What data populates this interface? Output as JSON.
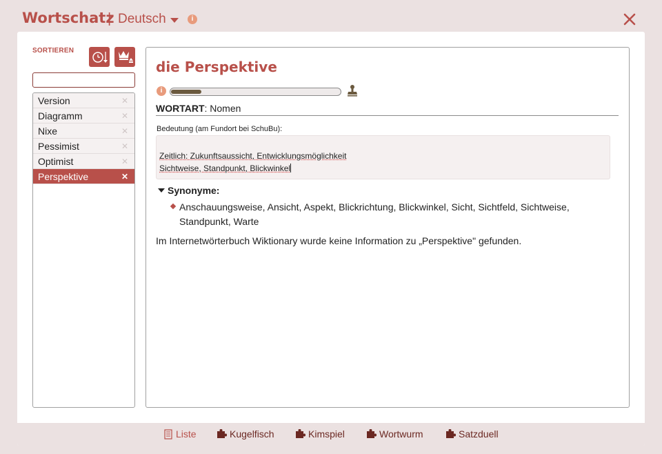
{
  "header": {
    "app_title": "Wortschatz",
    "separator": "|",
    "language": "Deutsch",
    "info_glyph": "i"
  },
  "sidebar": {
    "sort_label": "SORTIEREN",
    "sort_buttons": [
      {
        "icon": "clock-sort-icon"
      },
      {
        "icon": "crown-sort-icon"
      }
    ],
    "search_value": "",
    "items": [
      {
        "label": "Version",
        "selected": false
      },
      {
        "label": "Diagramm",
        "selected": false
      },
      {
        "label": "Nixe",
        "selected": false
      },
      {
        "label": "Pessimist",
        "selected": false
      },
      {
        "label": "Optimist",
        "selected": false
      },
      {
        "label": "Perspektive",
        "selected": true
      }
    ],
    "remove_glyph": "✕"
  },
  "detail": {
    "title": "die Perspektive",
    "info_glyph": "i",
    "progress": 0.18,
    "pos_key": "WORTART",
    "pos_sep": ":",
    "pos_value": "Nomen",
    "meaning_label": "Bedeutung (am Fundort bei SchuBu):",
    "meaning_line1": "Zeitlich: Zukunftsaussicht, Entwicklungsmöglichkeit",
    "meaning_line2": "Sichtweise, Standpunkt, Blickwinkel",
    "synonyms_heading": "Synonyme:",
    "synonyms_text": "Anschauungsweise, Ansicht, Aspekt, Blickrichtung, Blickwinkel, Sicht, Sichtfeld, Sichtweise, Standpunkt, Warte",
    "wiki_note": "Im Internetwörterbuch Wiktionary wurde keine Information zu „Perspektive\" gefunden."
  },
  "footer": {
    "tabs": [
      {
        "label": "Liste",
        "active": true,
        "icon": "list-icon"
      },
      {
        "label": "Kugelfisch",
        "active": false,
        "icon": "puzzle-icon"
      },
      {
        "label": "Kimspiel",
        "active": false,
        "icon": "puzzle-icon"
      },
      {
        "label": "Wortwurm",
        "active": false,
        "icon": "puzzle-icon"
      },
      {
        "label": "Satzduell",
        "active": false,
        "icon": "puzzle-icon"
      }
    ]
  },
  "colors": {
    "accent": "#b8504a",
    "background": "#ebe1e1",
    "progress_fill": "#6b5a3f"
  }
}
